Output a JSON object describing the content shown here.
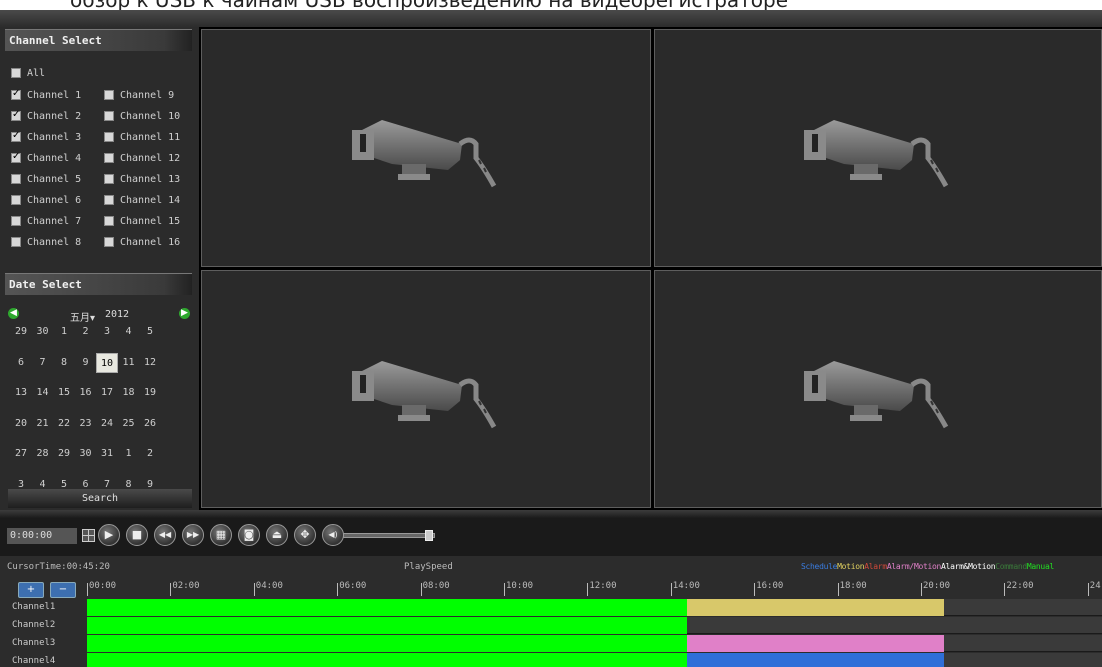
{
  "window": {
    "top_caption": "обзор к USB к чайнам USB воспроизведению на видеорегистраторе"
  },
  "channel_select": {
    "title": "Channel Select",
    "all_label": "All",
    "all_checked": false,
    "channels": [
      {
        "label": "Channel 1",
        "checked": true
      },
      {
        "label": "Channel 2",
        "checked": true
      },
      {
        "label": "Channel 3",
        "checked": true
      },
      {
        "label": "Channel 4",
        "checked": true
      },
      {
        "label": "Channel 5",
        "checked": false
      },
      {
        "label": "Channel 6",
        "checked": false
      },
      {
        "label": "Channel 7",
        "checked": false
      },
      {
        "label": "Channel 8",
        "checked": false
      },
      {
        "label": "Channel 9",
        "checked": false
      },
      {
        "label": "Channel 10",
        "checked": false
      },
      {
        "label": "Channel 11",
        "checked": false
      },
      {
        "label": "Channel 12",
        "checked": false
      },
      {
        "label": "Channel 13",
        "checked": false
      },
      {
        "label": "Channel 14",
        "checked": false
      },
      {
        "label": "Channel 15",
        "checked": false
      },
      {
        "label": "Channel 16",
        "checked": false
      }
    ]
  },
  "date_select": {
    "title": "Date Select",
    "month": "五月▾",
    "year": "2012",
    "prev_icon": "left-arrow-icon",
    "next_icon": "right-arrow-icon",
    "weeks": [
      [
        "29",
        "30",
        "1",
        "2",
        "3",
        "4",
        "5"
      ],
      [
        "6",
        "7",
        "8",
        "9",
        "10",
        "11",
        "12"
      ],
      [
        "13",
        "14",
        "15",
        "16",
        "17",
        "18",
        "19"
      ],
      [
        "20",
        "21",
        "22",
        "23",
        "24",
        "25",
        "26"
      ],
      [
        "27",
        "28",
        "29",
        "30",
        "31",
        "1",
        "2"
      ],
      [
        "3",
        "4",
        "5",
        "6",
        "7",
        "8",
        "9"
      ]
    ],
    "selected_day": "10",
    "search_label": "Search"
  },
  "video_panes": [
    {
      "icon": "camera-icon"
    },
    {
      "icon": "camera-icon"
    },
    {
      "icon": "camera-icon"
    },
    {
      "icon": "camera-icon"
    }
  ],
  "controls": {
    "time_display": "0:00:00",
    "buttons": [
      {
        "name": "play-button",
        "glyph": "▶"
      },
      {
        "name": "stop-button",
        "glyph": "■"
      },
      {
        "name": "rewind-button",
        "glyph": "◀◀"
      },
      {
        "name": "fast-forward-button",
        "glyph": "▶▶"
      },
      {
        "name": "frame-step-button",
        "glyph": "▦"
      },
      {
        "name": "snapshot-button",
        "glyph": "◙"
      },
      {
        "name": "backup-button",
        "glyph": "⏏"
      },
      {
        "name": "fullscreen-button",
        "glyph": "✥"
      },
      {
        "name": "volume-button",
        "glyph": "◀)"
      }
    ],
    "volume_level": 0.93
  },
  "timeline": {
    "cursor_time": "CursorTime:00:45:20",
    "play_speed": "PlaySpeed",
    "legend": [
      {
        "label": "Schedule",
        "color": "#3a7ce0"
      },
      {
        "label": "Motion",
        "color": "#e0d060"
      },
      {
        "label": "Alarm",
        "color": "#d04a3a"
      },
      {
        "label": "Alarm/Motion",
        "color": "#e080c8"
      },
      {
        "label": "Alarm&Motion",
        "color": "#ffffff"
      },
      {
        "label": "Command",
        "color": "#3a7a3a"
      },
      {
        "label": "Manual",
        "color": "#22dd22"
      }
    ],
    "zoom_in_icon": "zoom-in-icon",
    "zoom_out_icon": "zoom-out-icon",
    "ticks": [
      "00:00",
      "02:00",
      "04:00",
      "06:00",
      "08:00",
      "10:00",
      "12:00",
      "14:00",
      "16:00",
      "18:00",
      "20:00",
      "22:00",
      "24"
    ],
    "channels": [
      {
        "label": "Channel1",
        "segments": [
          {
            "start": 0,
            "end": 14.4,
            "type": "Manual",
            "color": "#00ff00"
          },
          {
            "start": 14.4,
            "end": 20.55,
            "type": "Motion",
            "color": "#d8c86a"
          }
        ]
      },
      {
        "label": "Channel2",
        "segments": [
          {
            "start": 0,
            "end": 14.4,
            "type": "Manual",
            "color": "#00ff00"
          }
        ]
      },
      {
        "label": "Channel3",
        "segments": [
          {
            "start": 0,
            "end": 14.4,
            "type": "Manual",
            "color": "#00ff00"
          },
          {
            "start": 14.4,
            "end": 20.55,
            "type": "Alarm/Motion",
            "color": "#e080c8"
          }
        ]
      },
      {
        "label": "Channel4",
        "segments": [
          {
            "start": 0,
            "end": 14.4,
            "type": "Manual",
            "color": "#00ff00"
          },
          {
            "start": 14.4,
            "end": 20.55,
            "type": "Schedule",
            "color": "#2f6fd8"
          }
        ]
      }
    ]
  }
}
